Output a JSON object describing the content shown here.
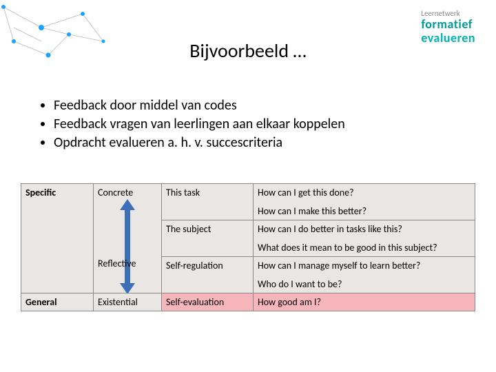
{
  "logo": {
    "l1": "Leernetwerk",
    "l2": "formatief",
    "l3": "evalueren"
  },
  "title": "Bijvoorbeeld …",
  "bullets": [
    "Feedback door middel van codes",
    "Feedback vragen van leerlingen aan elkaar koppelen",
    "Opdracht evalueren a. h. v. succescriteria"
  ],
  "table": {
    "r1": {
      "c1": "Specific",
      "c2": "Concrete",
      "c3": "This task",
      "c4a": "How can I get this done?",
      "c4b": "How can I make this better?"
    },
    "r2": {
      "c3": "The subject",
      "c4a": "How can I do better in tasks like this?",
      "c4b": "What does it mean to be good in this subject?"
    },
    "r2c2": "Reflective",
    "r3": {
      "c3": "Self-regulation",
      "c4a": "How can I manage myself to learn better?",
      "c4b": "Who do I want to be?"
    },
    "r4": {
      "c1": "General",
      "c2": "Existential",
      "c3": "Self-evaluation",
      "c4": "How good am I?"
    }
  }
}
